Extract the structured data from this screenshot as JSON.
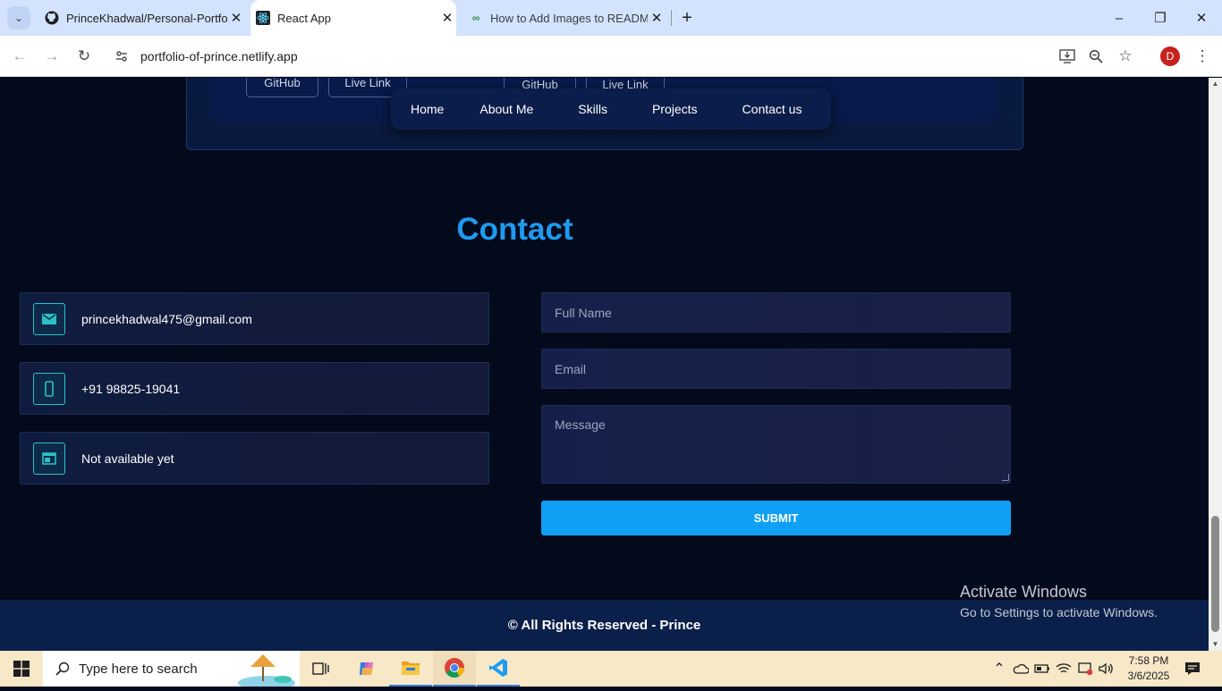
{
  "browser": {
    "tabs": [
      {
        "title": "PrinceKhadwal/Personal-Portfo",
        "icon": "github-icon"
      },
      {
        "title": "React App",
        "icon": "react-icon"
      },
      {
        "title": "How to Add Images to README",
        "icon": "geeksforgeeks-icon"
      }
    ],
    "url": "portfolio-of-prince.netlify.app",
    "profile_initial": "D"
  },
  "projects_card": {
    "buttons_left": [
      "GitHub",
      "Live Link"
    ],
    "buttons_right": [
      "GitHub",
      "Live Link"
    ]
  },
  "nav": {
    "items": [
      "Home",
      "About Me",
      "Skills",
      "Projects",
      "Contact us"
    ]
  },
  "contact": {
    "title": "Contact",
    "info": [
      {
        "icon": "mail-icon",
        "text": "princekhadwal475@gmail.com"
      },
      {
        "icon": "phone-icon",
        "text": "+91 98825-19041"
      },
      {
        "icon": "window-icon",
        "text": "Not available yet"
      }
    ],
    "form": {
      "name_placeholder": "Full Name",
      "email_placeholder": "Email",
      "message_placeholder": "Message",
      "submit_label": "SUBMIT"
    }
  },
  "footer": {
    "text": "© All Rights Reserved - Prince"
  },
  "watermark": {
    "line1": "Activate Windows",
    "line2": "Go to Settings to activate Windows."
  },
  "taskbar": {
    "search_placeholder": "Type here to search",
    "time": "7:58 PM",
    "date": "3/6/2025"
  },
  "colors": {
    "accent": "#1e9bf0",
    "page_bg": "#030a1c",
    "footer_bg": "#0a1f4a",
    "submit": "#0fa0f5"
  }
}
